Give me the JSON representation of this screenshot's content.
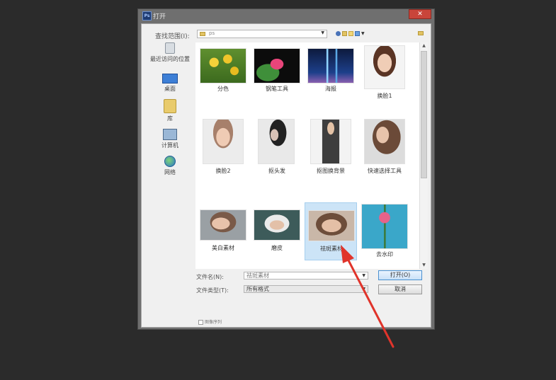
{
  "app": {
    "icon_text": "Ps",
    "title": "打开",
    "close_symbol": "✕"
  },
  "lookin": {
    "label": "查找范围(I):",
    "value": "ps"
  },
  "places": [
    {
      "label": "最近访问的位置",
      "icon": "recent-places-icon"
    },
    {
      "label": "桌面",
      "icon": "desktop-icon"
    },
    {
      "label": "库",
      "icon": "library-icon"
    },
    {
      "label": "计算机",
      "icon": "computer-icon"
    },
    {
      "label": "网络",
      "icon": "network-icon"
    }
  ],
  "files": [
    {
      "label": "分色"
    },
    {
      "label": "钢笔工具"
    },
    {
      "label": "海报"
    },
    {
      "label": "换脸1"
    },
    {
      "label": "换脸2"
    },
    {
      "label": "抠头发"
    },
    {
      "label": "抠图换背景"
    },
    {
      "label": "快速选择工具"
    },
    {
      "label": "美白素材"
    },
    {
      "label": "磨皮"
    },
    {
      "label": "祛斑素材"
    },
    {
      "label": "去水印"
    }
  ],
  "selected_file": "祛斑素材",
  "filename": {
    "label": "文件名(N):",
    "value": "祛斑素材"
  },
  "filetype": {
    "label": "文件类型(T):",
    "value": "所有格式"
  },
  "buttons": {
    "open": "打开(O)",
    "cancel": "取消"
  },
  "checkbox": {
    "label": "图像序列"
  },
  "colors": {
    "selection": "#cce4f7",
    "annotation_arrow": "#e0342b",
    "background": "#2b2b2b"
  }
}
